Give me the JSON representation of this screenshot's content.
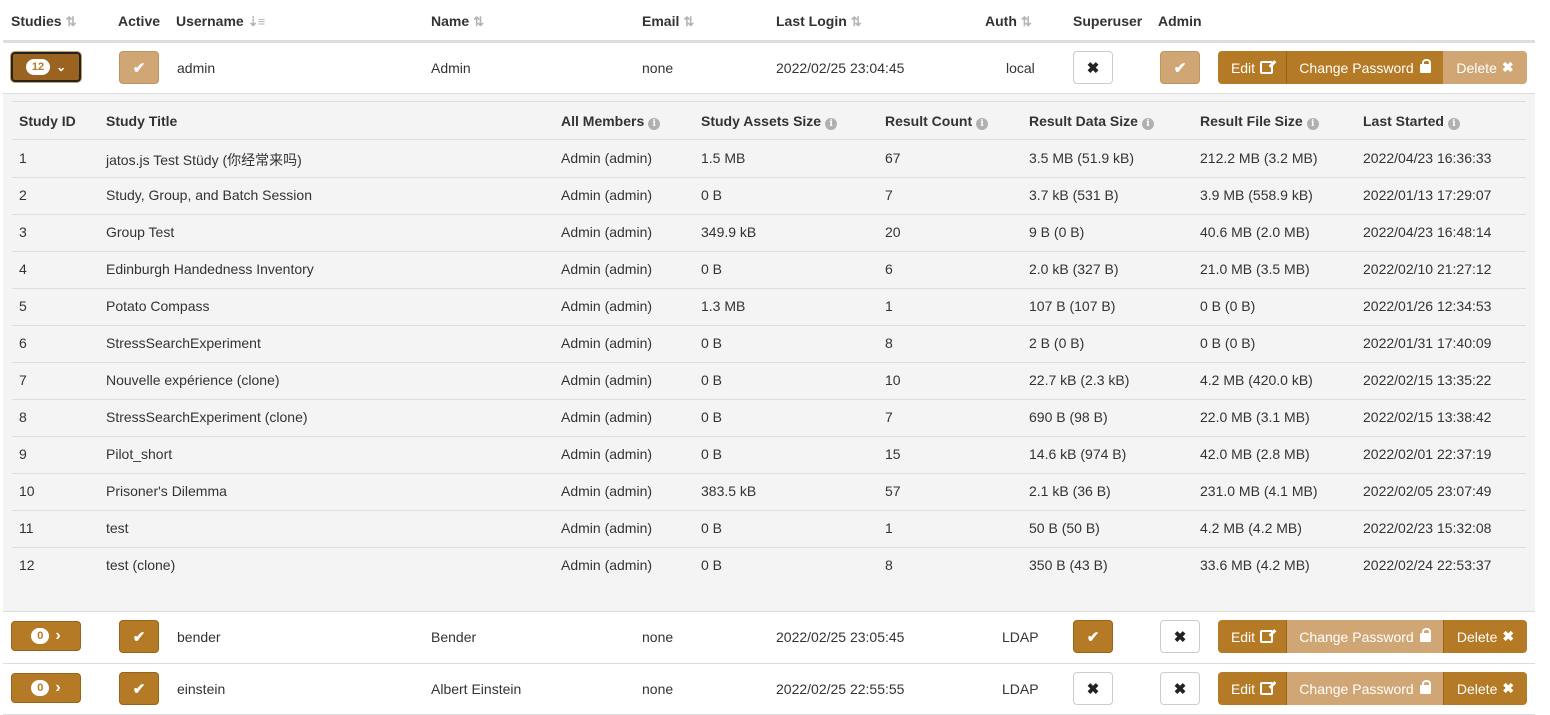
{
  "headers": {
    "studies": "Studies",
    "active": "Active",
    "username": "Username",
    "name": "Name",
    "email": "Email",
    "last_login": "Last Login",
    "auth": "Auth",
    "superuser": "Superuser",
    "admin": "Admin",
    "sort_icon": "⇅",
    "sort_active_icon": "⇣≡"
  },
  "colors": {
    "accent": "#b47a25",
    "accent_light": "#cfa674",
    "nested_bg": "#f4f4f4"
  },
  "icons": {
    "check": "✔",
    "cross": "✖",
    "chevron_down": "⌄",
    "chevron_right": "›",
    "info": "i"
  },
  "buttons": {
    "edit": "Edit",
    "change_password": "Change Password",
    "delete": "Delete"
  },
  "users": [
    {
      "studies_count": "12",
      "expanded": true,
      "active": true,
      "username": "admin",
      "name": "Admin",
      "email": "none",
      "last_login": "2022/02/25 23:04:45",
      "auth": "local",
      "superuser": false,
      "admin": true
    },
    {
      "studies_count": "0",
      "expanded": false,
      "active": true,
      "username": "bender",
      "name": "Bender",
      "email": "none",
      "last_login": "2022/02/25 23:05:45",
      "auth": "LDAP",
      "superuser": true,
      "admin": false
    },
    {
      "studies_count": "0",
      "expanded": false,
      "active": true,
      "username": "einstein",
      "name": "Albert Einstein",
      "email": "none",
      "last_login": "2022/02/25 22:55:55",
      "auth": "LDAP",
      "superuser": false,
      "admin": false
    }
  ],
  "studies_table": {
    "headers": {
      "id": "Study ID",
      "title": "Study Title",
      "members": "All Members",
      "assets": "Study Assets Size",
      "count": "Result Count",
      "data_size": "Result Data Size",
      "file_size": "Result File Size",
      "last_started": "Last Started"
    },
    "rows": [
      {
        "id": "1",
        "title": "jatos.js Test Stüdy (你经常来吗)",
        "members": "Admin (admin)",
        "assets": "1.5 MB",
        "count": "67",
        "data_size": "3.5 MB (51.9 kB)",
        "file_size": "212.2 MB (3.2 MB)",
        "last_started": "2022/04/23 16:36:33"
      },
      {
        "id": "2",
        "title": "Study, Group, and Batch Session",
        "members": "Admin (admin)",
        "assets": "0 B",
        "count": "7",
        "data_size": "3.7 kB (531 B)",
        "file_size": "3.9 MB (558.9 kB)",
        "last_started": "2022/01/13 17:29:07"
      },
      {
        "id": "3",
        "title": "Group Test",
        "members": "Admin (admin)",
        "assets": "349.9 kB",
        "count": "20",
        "data_size": "9 B (0 B)",
        "file_size": "40.6 MB (2.0 MB)",
        "last_started": "2022/04/23 16:48:14"
      },
      {
        "id": "4",
        "title": "Edinburgh Handedness Inventory",
        "members": "Admin (admin)",
        "assets": "0 B",
        "count": "6",
        "data_size": "2.0 kB (327 B)",
        "file_size": "21.0 MB (3.5 MB)",
        "last_started": "2022/02/10 21:27:12"
      },
      {
        "id": "5",
        "title": "Potato Compass",
        "members": "Admin (admin)",
        "assets": "1.3 MB",
        "count": "1",
        "data_size": "107 B (107 B)",
        "file_size": "0 B (0 B)",
        "last_started": "2022/01/26 12:34:53"
      },
      {
        "id": "6",
        "title": "StressSearchExperiment",
        "members": "Admin (admin)",
        "assets": "0 B",
        "count": "8",
        "data_size": "2 B (0 B)",
        "file_size": "0 B (0 B)",
        "last_started": "2022/01/31 17:40:09"
      },
      {
        "id": "7",
        "title": "Nouvelle expérience (clone)",
        "members": "Admin (admin)",
        "assets": "0 B",
        "count": "10",
        "data_size": "22.7 kB (2.3 kB)",
        "file_size": "4.2 MB (420.0 kB)",
        "last_started": "2022/02/15 13:35:22"
      },
      {
        "id": "8",
        "title": "StressSearchExperiment (clone)",
        "members": "Admin (admin)",
        "assets": "0 B",
        "count": "7",
        "data_size": "690 B (98 B)",
        "file_size": "22.0 MB (3.1 MB)",
        "last_started": "2022/02/15 13:38:42"
      },
      {
        "id": "9",
        "title": "Pilot_short",
        "members": "Admin (admin)",
        "assets": "0 B",
        "count": "15",
        "data_size": "14.6 kB (974 B)",
        "file_size": "42.0 MB (2.8 MB)",
        "last_started": "2022/02/01 22:37:19"
      },
      {
        "id": "10",
        "title": "Prisoner's Dilemma",
        "members": "Admin (admin)",
        "assets": "383.5 kB",
        "count": "57",
        "data_size": "2.1 kB (36 B)",
        "file_size": "231.0 MB (4.1 MB)",
        "last_started": "2022/02/05 23:07:49"
      },
      {
        "id": "11",
        "title": "test",
        "members": "Admin (admin)",
        "assets": "0 B",
        "count": "1",
        "data_size": "50 B (50 B)",
        "file_size": "4.2 MB (4.2 MB)",
        "last_started": "2022/02/23 15:32:08"
      },
      {
        "id": "12",
        "title": "test (clone)",
        "members": "Admin (admin)",
        "assets": "0 B",
        "count": "8",
        "data_size": "350 B (43 B)",
        "file_size": "33.6 MB (4.2 MB)",
        "last_started": "2022/02/24 22:53:37"
      }
    ]
  }
}
